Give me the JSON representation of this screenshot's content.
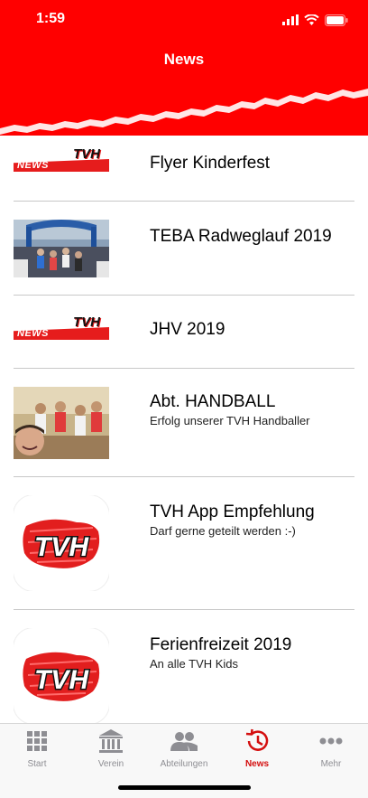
{
  "status_bar": {
    "time": "1:59"
  },
  "nav": {
    "title": "News"
  },
  "news_logo": {
    "word": "NEWS",
    "brand": "TVH"
  },
  "items": [
    {
      "title": "Flyer Kinderfest",
      "subtitle": ""
    },
    {
      "title": "TEBA Radweglauf 2019",
      "subtitle": ""
    },
    {
      "title": "JHV 2019",
      "subtitle": ""
    },
    {
      "title": "Abt. HANDBALL",
      "subtitle": "Erfolg unserer TVH Handballer"
    },
    {
      "title": "TVH App Empfehlung",
      "subtitle": "Darf gerne geteilt werden :-)"
    },
    {
      "title": "Ferienfreizeit 2019",
      "subtitle": "An alle TVH Kids"
    }
  ],
  "tabs": [
    {
      "label": "Start",
      "icon": "grid-icon"
    },
    {
      "label": "Verein",
      "icon": "bank-icon"
    },
    {
      "label": "Abteilungen",
      "icon": "people-icon"
    },
    {
      "label": "News",
      "icon": "history-clock-icon",
      "active": true
    },
    {
      "label": "Mehr",
      "icon": "more-dots-icon"
    }
  ],
  "colors": {
    "brand_red": "#ff0000",
    "active_tab": "#d40f0f",
    "inactive_tab": "#8e8e93"
  }
}
